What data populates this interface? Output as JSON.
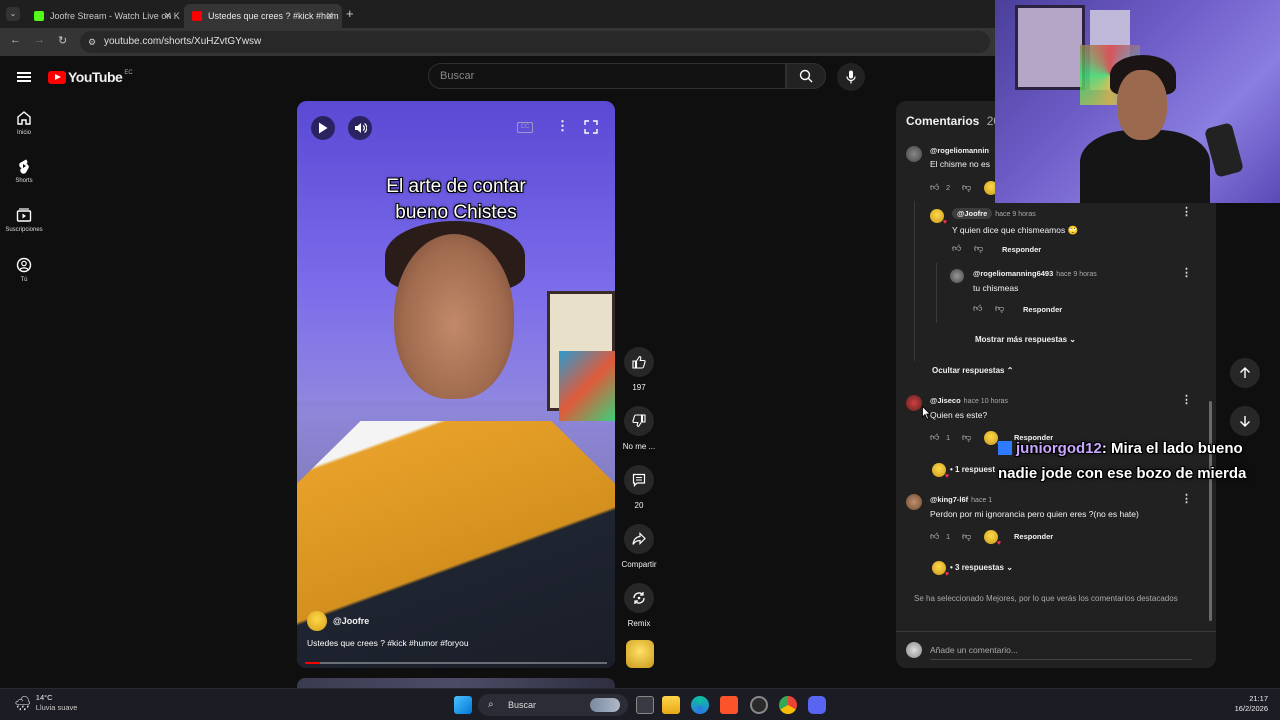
{
  "browser": {
    "tabs": [
      {
        "title": "Joofre Stream - Watch Live on K",
        "favicon_color": "#53fc18",
        "active": false
      },
      {
        "title": "Ustedes que crees ? #kick #hum",
        "favicon_color": "#ff0000",
        "active": true
      }
    ],
    "url": "youtube.com/shorts/XuHZvtGYwsw"
  },
  "youtube": {
    "logo_text": "YouTube",
    "country": "EC",
    "search_placeholder": "Buscar"
  },
  "sidebar": {
    "items": [
      {
        "label": "Inicio",
        "icon": "home-icon"
      },
      {
        "label": "Shorts",
        "icon": "shorts-icon"
      },
      {
        "label": "Suscripciones",
        "icon": "subscriptions-icon"
      },
      {
        "label": "Tú",
        "icon": "you-icon"
      }
    ]
  },
  "video": {
    "title_line1": "El arte de contar",
    "title_line2": "bueno Chistes",
    "owner": "@Joofre",
    "caption": "Ustedes que crees ? #kick #humor #foryou",
    "progress": 0.05
  },
  "actions": {
    "likes": "197",
    "dislike_label": "No me ...",
    "comments": "20",
    "share": "Compartir",
    "remix": "Remix"
  },
  "comments": {
    "header": "Comentarios",
    "count": "20",
    "items": [
      {
        "user": "@rogeliomannin",
        "text": "El chisme no es",
        "likes": "2"
      },
      {
        "user": "@Joofre",
        "time": "hace 9 horas",
        "text": "Y quien dice que chismeamos 🙄",
        "reply": "Responder"
      },
      {
        "user": "@rogeliomanning6493",
        "time": "hace 9 horas",
        "text": "tu chismeas",
        "reply": "Responder"
      },
      {
        "user": "@Jiseco",
        "time": "hace 10 horas",
        "text": "Quien es este?",
        "likes": "1",
        "reply": "Responder"
      },
      {
        "user": "@king7-l6f",
        "time": "hace 1",
        "text": "Perdon por mi ignorancia pero quien eres ?(no es hate)",
        "likes": "1",
        "reply": "Responder"
      }
    ],
    "show_more": "Mostrar más respuestas",
    "hide_replies": "Ocultar respuestas",
    "replies_1": "• 1 respuest",
    "replies_3": "• 3 respuestas",
    "note": "Se ha seleccionado Mejores, por lo que verás los comentarios destacados",
    "add_placeholder": "Añade un comentario..."
  },
  "chat_overlay": {
    "username": "juniorgod12",
    "message": ": Mira el lado bueno nadie jode con ese bozo de mierda"
  },
  "taskbar": {
    "weather_temp": "14°C",
    "weather_desc": "Lluvia suave",
    "search": "Buscar",
    "time": "21:17",
    "date": "16/2/2026"
  }
}
